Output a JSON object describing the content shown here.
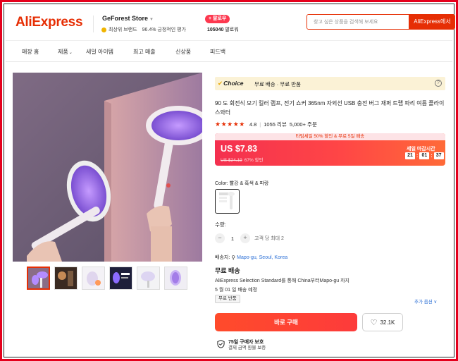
{
  "header": {
    "logo": "AliExpress",
    "store_name": "GeForest Store",
    "store_badge": "최상위 브랜드",
    "positive_rating": "96.4% 긍정적인 평가",
    "follow_label": "+ 팔로우",
    "followers_count": "105040",
    "followers_label": "팔로워",
    "search_placeholder": "찾고 싶은 상품을 검색해 보세요",
    "search_button": "AliExpress에서"
  },
  "nav": {
    "items": [
      "매장 홈",
      "제품",
      "세일 아이템",
      "최고 매출",
      "신상품",
      "피드백"
    ]
  },
  "choice": {
    "label": "Choice",
    "text": "무료 배송 · 무료 반품",
    "help": "?"
  },
  "product": {
    "title": "90 도 회전식 모기 킬러 램프, 전기 쇼커 365nm 자외선 USB 충전 버그 재퍼 트랩 파리 여름 플라이 스와터",
    "stars": "★★★★★",
    "rating": "4.8",
    "reviews": "1055 리뷰",
    "orders": "5,000+ 주문"
  },
  "promo": {
    "banner": "타임세일 50% 할인 & 무료 5일 배송",
    "price": "US $7.83",
    "original_price": "US $24.19",
    "discount": "67% 할인",
    "sale_label": "세일 마감시간",
    "countdown": [
      "21",
      "01",
      "37"
    ]
  },
  "variant": {
    "color_label": "Color: 빨강 & 흑색 & 파랑"
  },
  "quantity": {
    "label": "수량:",
    "minus": "−",
    "value": "1",
    "plus": "+",
    "limit_note": "고객 당 최대 2"
  },
  "shipping": {
    "to_label": "배송지:",
    "location": "Mapo-gu, Seoul, Korea",
    "title": "무료 배송",
    "description": "AliExpress Selection Standard를 통해 China부터Mapo-gu 까지",
    "eta": "5 월 01 일 배송 예정",
    "tag": "무료 반품",
    "more_options": "추가 옵션 ∨"
  },
  "actions": {
    "buy_now": "바로 구매",
    "wishlist_count": "32.1K"
  },
  "protection": {
    "title": "75일 구매자 보호",
    "subtitle": "결제 금액 환불 보증"
  },
  "colors": {
    "brand": "#e62e04",
    "price_bg": "#fd384f",
    "choice_bg": "#fbf2d6",
    "link": "#2b6fd6"
  }
}
